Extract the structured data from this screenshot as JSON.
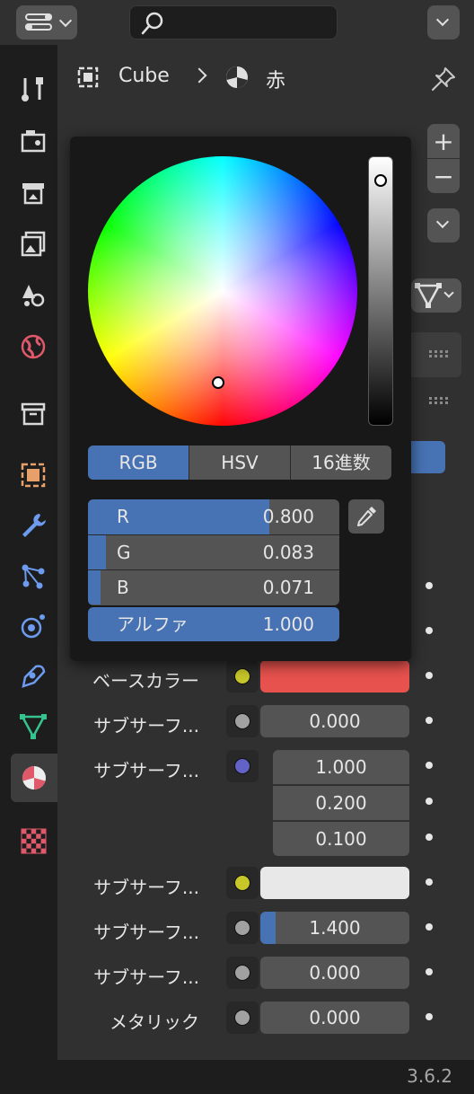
{
  "header": {
    "editor_type_icon": "properties-editor-icon",
    "search_placeholder": "",
    "options_icon": "chevron-down-icon"
  },
  "tabs": [
    {
      "name": "tool",
      "icon": "tool-icon",
      "color": "#d9d9d9"
    },
    {
      "name": "render",
      "icon": "camera-back-icon",
      "color": "#d9d9d9"
    },
    {
      "name": "output",
      "icon": "printer-icon",
      "color": "#d9d9d9"
    },
    {
      "name": "view-layer",
      "icon": "image-stack-icon",
      "color": "#d9d9d9"
    },
    {
      "name": "scene",
      "icon": "scene-icon",
      "color": "#d9d9d9"
    },
    {
      "name": "world",
      "icon": "world-icon",
      "color": "#e0596b"
    },
    {
      "name": "collection",
      "icon": "box-icon",
      "color": "#d9d9d9"
    },
    {
      "name": "object",
      "icon": "object-square-icon",
      "color": "#e8a06a"
    },
    {
      "name": "modifiers",
      "icon": "wrench-icon",
      "color": "#6c9bf0"
    },
    {
      "name": "particles",
      "icon": "particles-icon",
      "color": "#6c9bf0"
    },
    {
      "name": "physics",
      "icon": "physics-icon",
      "color": "#6c9bf0"
    },
    {
      "name": "constraints",
      "icon": "constraint-icon",
      "color": "#6c9bf0"
    },
    {
      "name": "data",
      "icon": "mesh-triangle-icon",
      "color": "#35c48e"
    },
    {
      "name": "material",
      "icon": "material-sphere-icon",
      "color": "#e0596b",
      "active": true
    },
    {
      "name": "texture",
      "icon": "checker-icon",
      "color": "#e0596b"
    }
  ],
  "breadcrumb": {
    "object_name": "Cube",
    "material_name": "赤"
  },
  "picker": {
    "modes": [
      "RGB",
      "HSV",
      "16進数"
    ],
    "active_mode": "RGB",
    "channels": [
      {
        "label": "R",
        "value": "0.800",
        "fraction": 0.8
      },
      {
        "label": "G",
        "value": "0.083",
        "fraction": 0.083
      },
      {
        "label": "B",
        "value": "0.071",
        "fraction": 0.071
      }
    ],
    "alpha": {
      "label": "アルファ",
      "value": "1.000",
      "fraction": 1.0
    }
  },
  "properties": [
    {
      "label": "ベースカラー",
      "type": "color",
      "socket_color": "#c7c729",
      "swatch": "#e8524e"
    },
    {
      "label": "サブサーフ...",
      "type": "value",
      "socket_color": "#a1a1a1",
      "value": "0.000",
      "fraction": 0
    },
    {
      "label": "サブサーフ...",
      "type": "vector",
      "socket_color": "#6363c7",
      "values": [
        "1.000",
        "0.200",
        "0.100"
      ]
    },
    {
      "label": "サブサーフ...",
      "type": "color",
      "socket_color": "#c7c729",
      "swatch": "#e8e8e8"
    },
    {
      "label": "サブサーフ...",
      "type": "value",
      "socket_color": "#a1a1a1",
      "value": "1.400",
      "fraction": 0.1
    },
    {
      "label": "サブサーフ...",
      "type": "value",
      "socket_color": "#a1a1a1",
      "value": "0.000",
      "fraction": 0
    },
    {
      "label": "メタリック",
      "type": "value",
      "socket_color": "#a1a1a1",
      "value": "0.000",
      "fraction": 0
    }
  ],
  "status": {
    "version": "3.6.2"
  },
  "colors": {
    "accent": "#4772b3",
    "panel": "#303030",
    "field": "#545454"
  }
}
